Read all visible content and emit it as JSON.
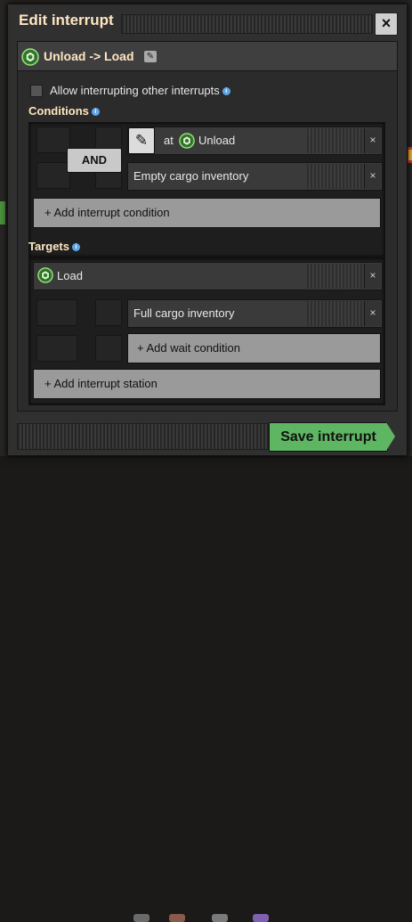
{
  "window": {
    "title": "Edit interrupt",
    "close_label": "×"
  },
  "interrupt": {
    "name": "Unload -> Load",
    "rename_icon": "pencil-icon",
    "allow_label": "Allow interrupting other interrupts",
    "allow_checked": false
  },
  "conditions": {
    "label": "Conditions",
    "and_label": "AND",
    "rows": [
      {
        "prefix": "at",
        "station": "Unload",
        "remove": "×"
      },
      {
        "text": "Empty cargo inventory",
        "remove": "×"
      }
    ],
    "add_label": "+ Add interrupt condition"
  },
  "targets": {
    "label": "Targets",
    "station": {
      "name": "Load",
      "remove": "×"
    },
    "wait_conditions": [
      {
        "text": "Full cargo inventory",
        "remove": "×"
      }
    ],
    "add_wait_label": "+ Add wait condition",
    "add_station_label": "+ Add interrupt station"
  },
  "footer": {
    "save_label": "Save interrupt"
  },
  "colors": {
    "title": "#ffe6c0",
    "accent_green": "#5eb663",
    "info_blue": "#5ea6e8"
  }
}
